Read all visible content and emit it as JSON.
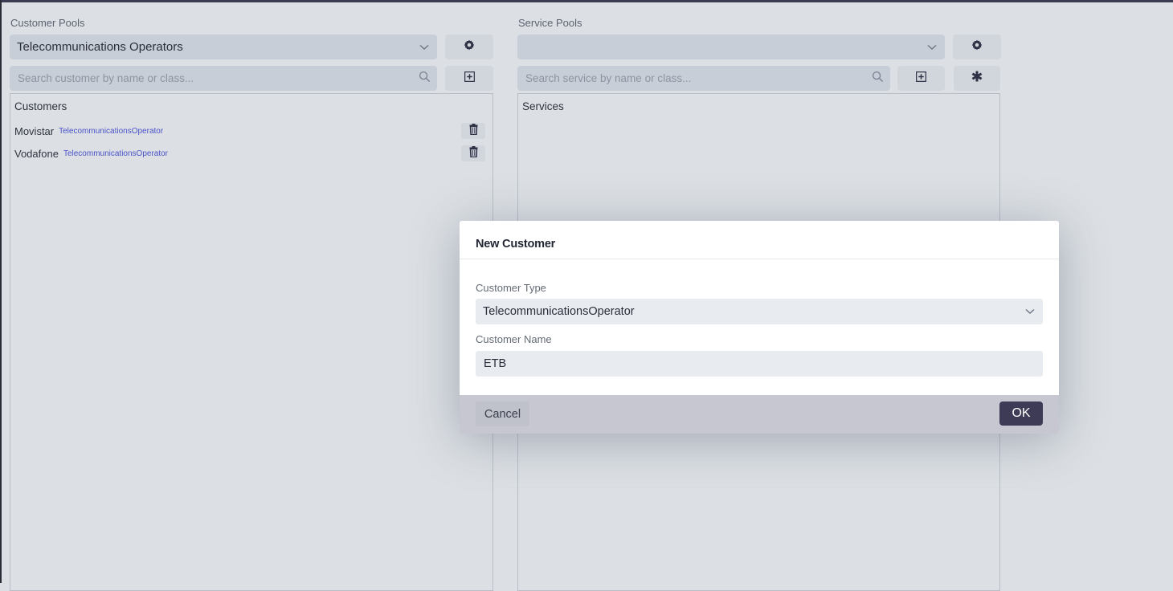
{
  "customer_pools": {
    "label": "Customer Pools",
    "selected_pool": "Telecommunications Operators",
    "search_placeholder": "Search customer by name or class...",
    "search_value": "",
    "settings_icon": "gear-icon",
    "add_icon": "plus-square-icon",
    "list_title": "Customers",
    "customers": [
      {
        "name": "Movistar",
        "class": "TelecommunicationsOperator",
        "delete_icon": "trash-icon"
      },
      {
        "name": "Vodafone",
        "class": "TelecommunicationsOperator",
        "delete_icon": "trash-icon"
      }
    ]
  },
  "service_pools": {
    "label": "Service Pools",
    "selected_pool": "",
    "search_placeholder": "Search service by name or class...",
    "search_value": "",
    "settings_icon": "gear-icon",
    "add_icon": "plus-square-icon",
    "extra_icon": "asterisk-icon",
    "list_title": "Services",
    "services": []
  },
  "dialog": {
    "title": "New Customer",
    "customer_type_label": "Customer Type",
    "customer_type_value": "TelecommunicationsOperator",
    "customer_name_label": "Customer Name",
    "customer_name_value": "ETB",
    "cancel_label": "Cancel",
    "ok_label": "OK"
  },
  "colors": {
    "accent_dark": "#3d3b55",
    "class_link": "#4a52c8",
    "background": "#dce0e4"
  }
}
